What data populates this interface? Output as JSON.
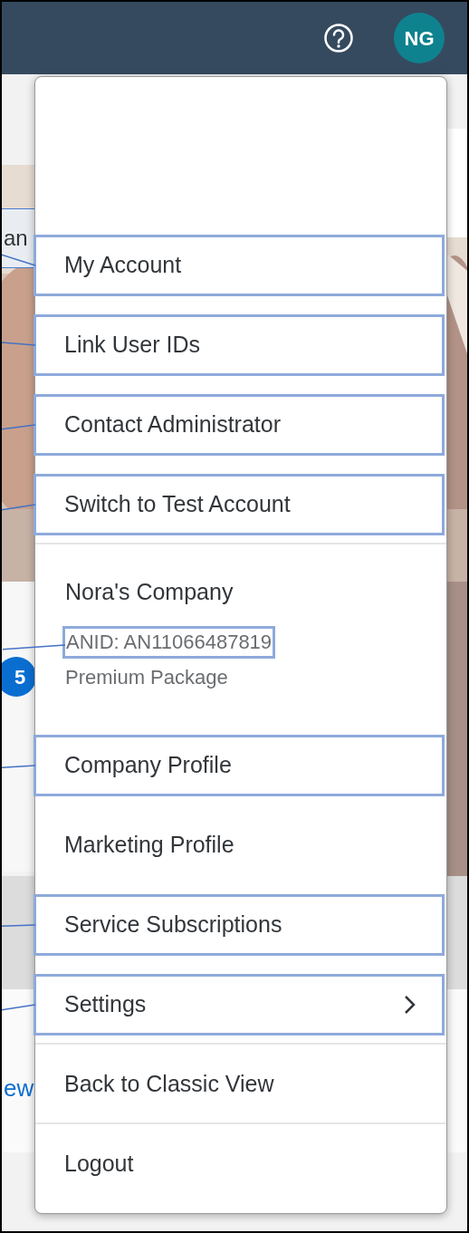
{
  "header": {
    "avatar_initials": "NG"
  },
  "background": {
    "fragment_text": "an",
    "badge": "5",
    "link_text": "ew"
  },
  "menu": {
    "items": [
      {
        "kind": "item",
        "label": "My Account",
        "highlighted": true,
        "submenu": false,
        "divider_after": false
      },
      {
        "kind": "item",
        "label": "Link User IDs",
        "highlighted": true,
        "submenu": false,
        "divider_after": false
      },
      {
        "kind": "item",
        "label": "Contact Administrator",
        "highlighted": true,
        "submenu": false,
        "divider_after": false
      },
      {
        "kind": "item",
        "label": "Switch to Test Account",
        "highlighted": true,
        "submenu": false,
        "divider_after": true
      },
      {
        "kind": "company",
        "name": "Nora's Company",
        "anid": "ANID: AN11066487819",
        "anid_highlighted": true,
        "package": "Premium Package"
      },
      {
        "kind": "item",
        "label": "Company Profile",
        "highlighted": true,
        "submenu": false,
        "divider_after": false
      },
      {
        "kind": "item",
        "label": "Marketing Profile",
        "highlighted": false,
        "submenu": false,
        "divider_after": false
      },
      {
        "kind": "item",
        "label": "Service Subscriptions",
        "highlighted": true,
        "submenu": false,
        "divider_after": false
      },
      {
        "kind": "item",
        "label": "Settings",
        "highlighted": true,
        "submenu": true,
        "divider_after": true
      },
      {
        "kind": "item",
        "label": "Back to Classic View",
        "highlighted": false,
        "submenu": false,
        "divider_after": true
      },
      {
        "kind": "item",
        "label": "Logout",
        "highlighted": false,
        "submenu": false,
        "divider_after": false
      }
    ]
  }
}
